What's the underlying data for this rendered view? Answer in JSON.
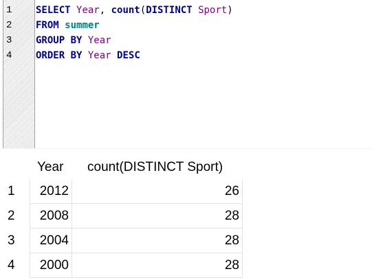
{
  "editor": {
    "line_numbers": [
      "1",
      "2",
      "3",
      "4"
    ],
    "lines": [
      [
        {
          "t": "SELECT",
          "c": "kw"
        },
        {
          "t": " ",
          "c": "plain"
        },
        {
          "t": "Year",
          "c": "id"
        },
        {
          "t": ", ",
          "c": "plain"
        },
        {
          "t": "count",
          "c": "kw"
        },
        {
          "t": "(",
          "c": "plain"
        },
        {
          "t": "DISTINCT",
          "c": "kw"
        },
        {
          "t": " ",
          "c": "plain"
        },
        {
          "t": "Sport",
          "c": "id"
        },
        {
          "t": ")",
          "c": "plain"
        }
      ],
      [
        {
          "t": "FROM",
          "c": "kw"
        },
        {
          "t": " ",
          "c": "plain"
        },
        {
          "t": "summer",
          "c": "tbl"
        }
      ],
      [
        {
          "t": "GROUP BY",
          "c": "kw"
        },
        {
          "t": " ",
          "c": "plain"
        },
        {
          "t": "Year",
          "c": "id"
        }
      ],
      [
        {
          "t": "ORDER BY",
          "c": "kw"
        },
        {
          "t": " ",
          "c": "plain"
        },
        {
          "t": "Year",
          "c": "id"
        },
        {
          "t": " ",
          "c": "plain"
        },
        {
          "t": "DESC",
          "c": "kw"
        }
      ]
    ]
  },
  "results": {
    "columns": [
      "Year",
      "count(DISTINCT Sport)"
    ],
    "rows": [
      {
        "n": "1",
        "cells": [
          "2012",
          "26"
        ]
      },
      {
        "n": "2",
        "cells": [
          "2008",
          "28"
        ]
      },
      {
        "n": "3",
        "cells": [
          "2004",
          "28"
        ]
      },
      {
        "n": "4",
        "cells": [
          "2000",
          "28"
        ]
      }
    ]
  },
  "colors": {
    "keyword": "#000080",
    "identifier": "#800080",
    "table": "#008080"
  }
}
